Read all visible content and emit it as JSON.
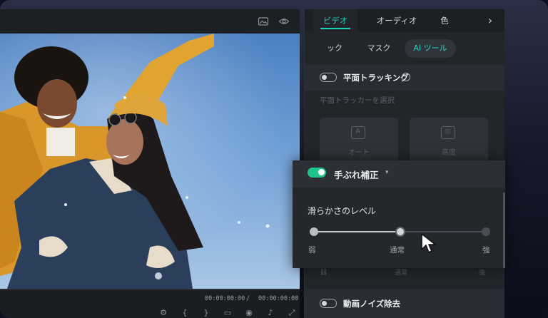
{
  "preview": {
    "timecode_current": "00:00:00:00",
    "timecode_separator": "/",
    "timecode_total": "00:00:00:00",
    "timeline_icons": [
      "settings-icon",
      "mark-in-icon",
      "mark-out-icon",
      "monitor-icon",
      "snapshot-icon",
      "volume-icon",
      "fullscreen-icon"
    ],
    "timeline_icon_glyphs": [
      "⚙",
      "{",
      "}",
      "▭",
      "◉",
      "♪",
      "⤢"
    ]
  },
  "panel": {
    "tabs": [
      {
        "label": "ビデオ",
        "active": true
      },
      {
        "label": "オーディオ",
        "active": false
      },
      {
        "label": "色",
        "active": false
      }
    ],
    "more_icon": "›",
    "subtabs": [
      {
        "label": "ック",
        "active": false
      },
      {
        "label": "マスク",
        "active": false
      },
      {
        "label": "AI ツール",
        "active": true
      }
    ],
    "planar_tracking": {
      "label": "平面トラッキング",
      "help": "?",
      "enabled": false
    },
    "select_tracker_label": "平面トラッカーを選択",
    "tracker_cards": [
      {
        "label": "オート",
        "glyph": "A"
      },
      {
        "label": "高度",
        "glyph": "◎"
      }
    ],
    "faint_ticks": {
      "low": "弱",
      "mid": "通常",
      "high": "強"
    },
    "denoise": {
      "label": "動画ノイズ除去",
      "enabled": false
    }
  },
  "popup": {
    "stabilization": {
      "label": "手ぶれ補正",
      "enabled": true,
      "caret": "▾"
    },
    "smoothness_label": "滑らかさのレベル",
    "slider": {
      "value_fraction": 0.5,
      "low": "弱",
      "mid": "通常",
      "high": "強"
    }
  },
  "colors": {
    "accent": "#1ad3b8",
    "toggle_on": "#1fc38e"
  }
}
